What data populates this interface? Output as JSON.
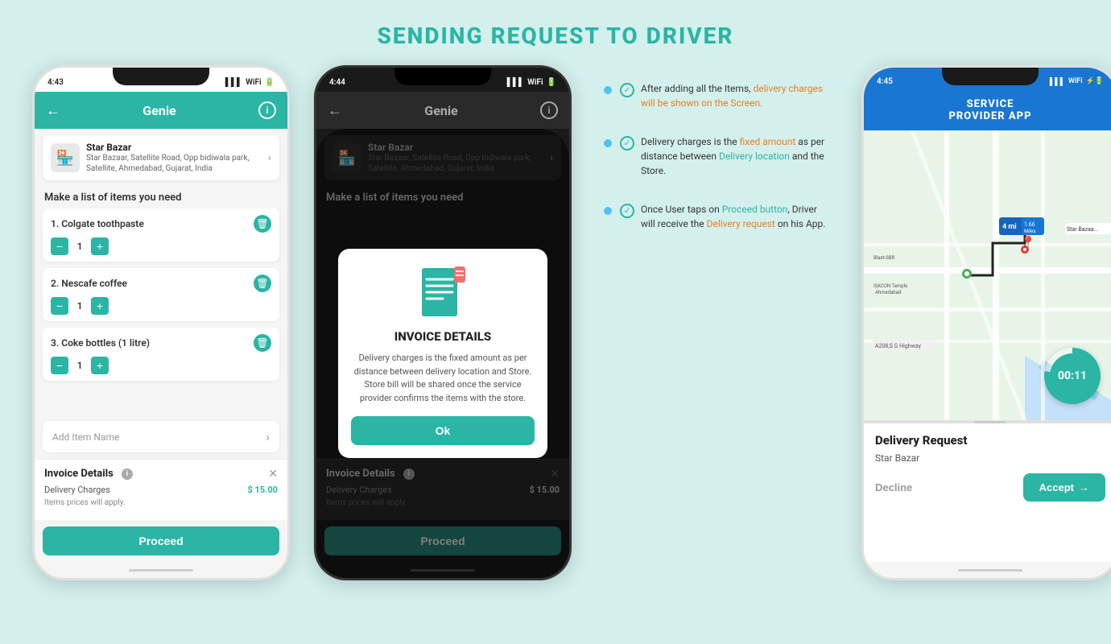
{
  "page": {
    "title": "SENDING REQUEST TO DRIVER",
    "bg_color": "#d4f0ec"
  },
  "phone1": {
    "time": "4:43",
    "title": "Genie",
    "store_name": "Star Bazar",
    "store_address": "Star Bazaar, Satellite Road, Opp bidiwala park, Satellite, Ahmedabad, Gujarat, India",
    "section_label": "Make a list of items you need",
    "items": [
      {
        "num": "1.",
        "name": "Colgate toothpaste",
        "qty": "1"
      },
      {
        "num": "2.",
        "name": "Nescafe coffee",
        "qty": "1"
      },
      {
        "num": "3.",
        "name": "Coke bottles (1 litre)",
        "qty": "1"
      }
    ],
    "add_item_placeholder": "Add Item Name",
    "invoice": {
      "title": "Invoice Details",
      "delivery_label": "Delivery Charges",
      "delivery_value": "$ 15.00",
      "note": "Items prices will apply."
    },
    "proceed_label": "Proceed"
  },
  "phone2": {
    "time": "4:44",
    "title": "Genie",
    "store_name": "Star Bazar",
    "store_address": "Star Bazaar, Satellite Road, Opp bidiwala park, Satellite, Ahmedabad, Gujarat, India",
    "section_label": "Make a list of items you need",
    "modal": {
      "title": "INVOICE DETAILS",
      "text": "Delivery charges is the fixed amount as per distance between delivery location and Store. Store bill will be shared once the service provider confirms the items with the store.",
      "ok_label": "Ok"
    },
    "invoice": {
      "title": "Invoice Details",
      "delivery_label": "Delivery Charges",
      "delivery_value": "$ 15.00",
      "note": "Items prices will apply."
    },
    "proceed_label": "Proceed"
  },
  "phone3": {
    "time": "4:45",
    "header_title": "SERVICE\nPROVIDER APP",
    "timer": "00:11",
    "delivery_request_title": "Delivery Request",
    "store_name": "Star Bazar",
    "decline_label": "Decline",
    "accept_label": "Accept"
  },
  "annotations": {
    "item1": "After adding all the Items, delivery charges will be shown on the Screen.",
    "item2": "Delivery charges is the fixed amount as per distance between Delivery location and the Store.",
    "item3": "Once User taps on Proceed button, Driver will receive the Delivery request on his App."
  }
}
